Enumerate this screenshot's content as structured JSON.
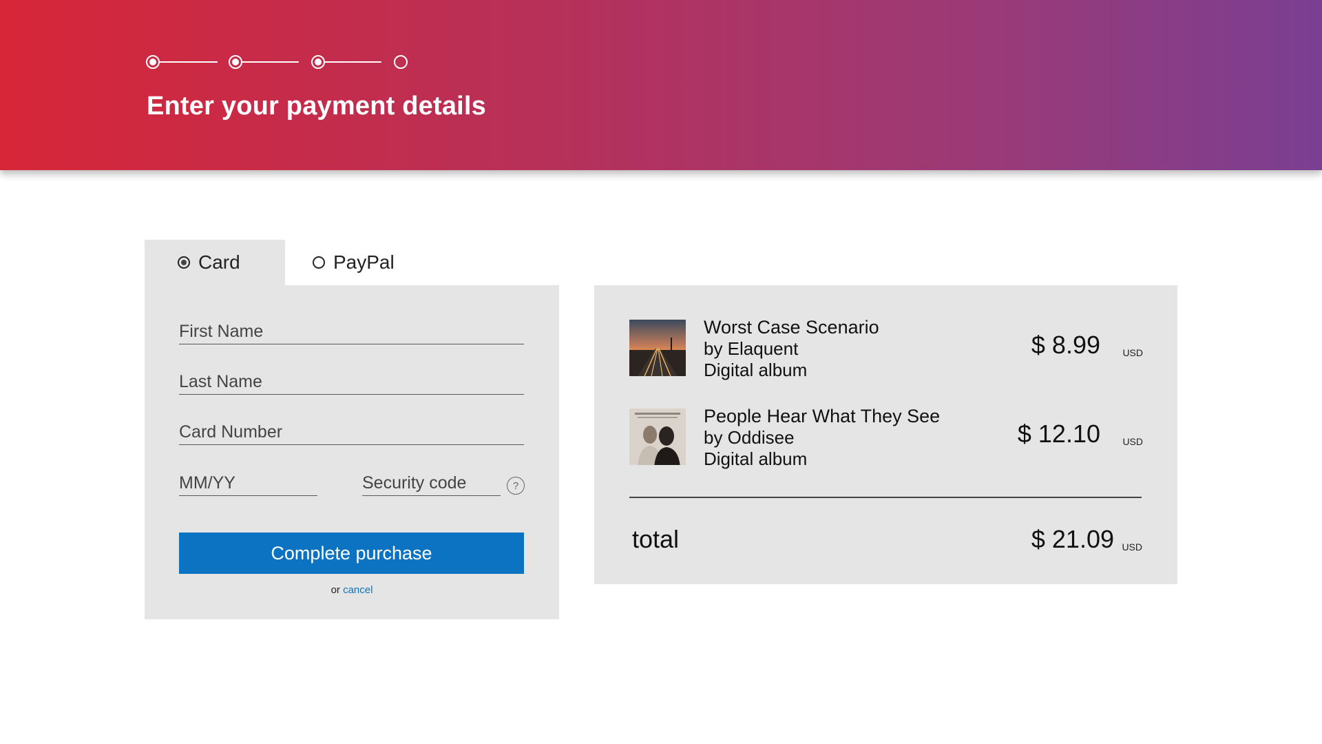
{
  "header": {
    "title": "Enter your payment details",
    "steps": [
      {
        "state": "done"
      },
      {
        "state": "done"
      },
      {
        "state": "done"
      },
      {
        "state": "pending"
      }
    ],
    "gradient_colors": [
      "#d72638",
      "#7a3f92"
    ]
  },
  "payment_tabs": {
    "card_label": "Card",
    "paypal_label": "PayPal",
    "selected": "Card"
  },
  "card_form": {
    "first_name_placeholder": "First Name",
    "last_name_placeholder": "Last Name",
    "card_number_placeholder": "Card Number",
    "expiry_placeholder": "MM/YY",
    "security_code_placeholder": "Security code",
    "help_icon_glyph": "?",
    "complete_label": "Complete purchase",
    "or_text": "or",
    "cancel_label": "cancel",
    "button_color": "#0b73c1"
  },
  "summary": {
    "items": [
      {
        "title": "Worst Case Scenario",
        "artist": "by Elaquent",
        "format": "Digital album",
        "price": "$ 8.99",
        "currency": "USD",
        "thumb_icon": "album-cover-road-sunset"
      },
      {
        "title": "People Hear What They See",
        "artist": "by Oddisee",
        "format": "Digital album",
        "price": "$ 12.10",
        "currency": "USD",
        "thumb_icon": "album-cover-portrait"
      }
    ],
    "total_label": "total",
    "total_price": "$ 21.09",
    "total_currency": "USD"
  }
}
